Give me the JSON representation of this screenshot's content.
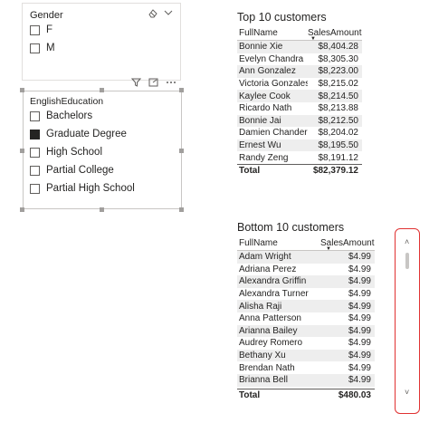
{
  "gender_slicer": {
    "title": "Gender",
    "items": [
      {
        "label": "F",
        "checked": false
      },
      {
        "label": "M",
        "checked": false
      }
    ]
  },
  "education_slicer": {
    "title": "EnglishEducation",
    "items": [
      {
        "label": "Bachelors",
        "checked": false
      },
      {
        "label": "Graduate Degree",
        "checked": true
      },
      {
        "label": "High School",
        "checked": false
      },
      {
        "label": "Partial College",
        "checked": false
      },
      {
        "label": "Partial High School",
        "checked": false
      }
    ]
  },
  "top_table": {
    "title": "Top 10 customers",
    "col1": "FullName",
    "col2": "SalesAmount",
    "rows": [
      [
        "Bonnie Xie",
        "$8,404.28"
      ],
      [
        "Evelyn Chandra",
        "$8,305.30"
      ],
      [
        "Ann Gonzalez",
        "$8,223.00"
      ],
      [
        "Victoria Gonzales",
        "$8,215.02"
      ],
      [
        "Kaylee Cook",
        "$8,214.50"
      ],
      [
        "Ricardo Nath",
        "$8,213.88"
      ],
      [
        "Bonnie Jai",
        "$8,212.50"
      ],
      [
        "Damien Chander",
        "$8,204.02"
      ],
      [
        "Ernest Wu",
        "$8,195.50"
      ],
      [
        "Randy Zeng",
        "$8,191.12"
      ]
    ],
    "total_label": "Total",
    "total_value": "$82,379.12"
  },
  "bottom_table": {
    "title": "Bottom 10 customers",
    "col1": "FullName",
    "col2": "SalesAmount",
    "rows": [
      [
        "Adam Wright",
        "$4.99"
      ],
      [
        "Adriana Perez",
        "$4.99"
      ],
      [
        "Alexandra Griffin",
        "$4.99"
      ],
      [
        "Alexandra Turner",
        "$4.99"
      ],
      [
        "Alisha Raji",
        "$4.99"
      ],
      [
        "Anna Patterson",
        "$4.99"
      ],
      [
        "Arianna Bailey",
        "$4.99"
      ],
      [
        "Audrey Romero",
        "$4.99"
      ],
      [
        "Bethany Xu",
        "$4.99"
      ],
      [
        "Brendan Nath",
        "$4.99"
      ],
      [
        "Brianna Bell",
        "$4.99"
      ]
    ],
    "total_label": "Total",
    "total_value": "$480.03"
  },
  "icons": {
    "eraser": "eraser-icon",
    "chevron": "chevron-down-icon",
    "filter": "filter-icon",
    "focus": "focus-mode-icon",
    "more": "more-options-icon"
  },
  "colors": {
    "highlight": "#e03131",
    "checked": "#252423"
  }
}
